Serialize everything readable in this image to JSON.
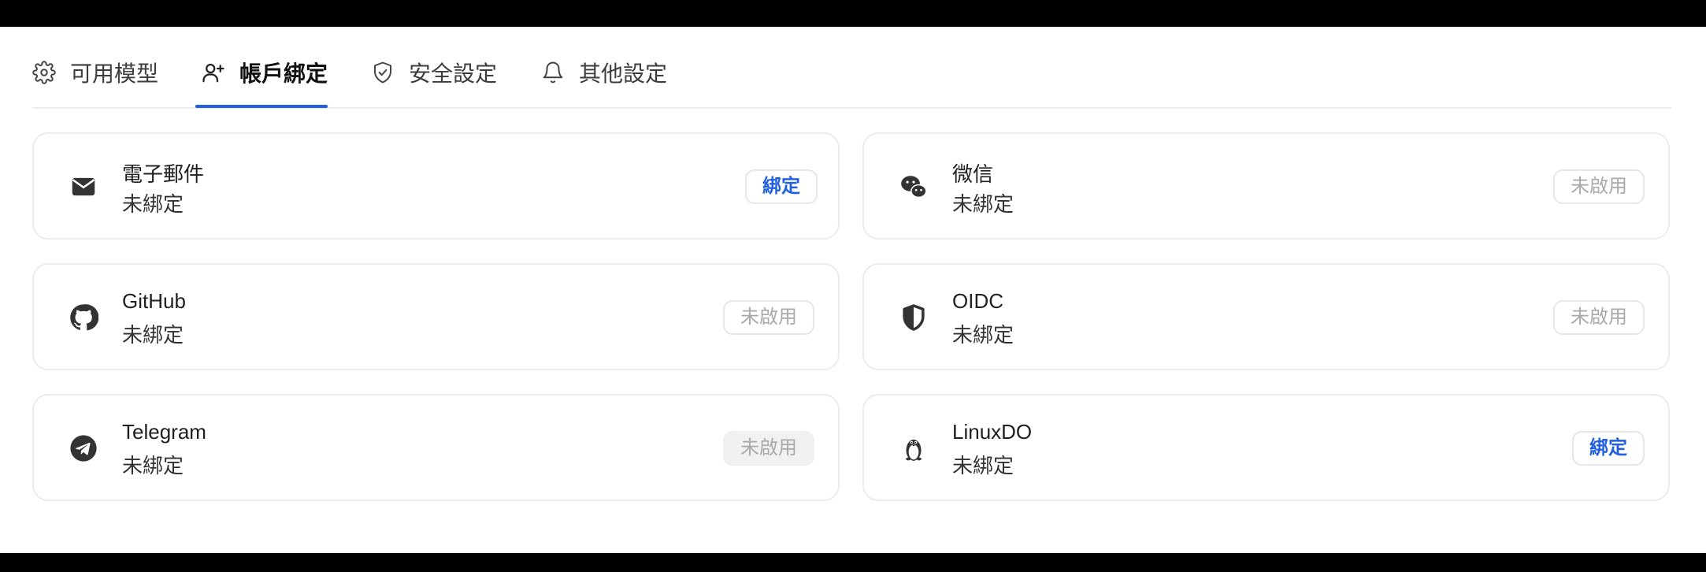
{
  "tabs": [
    {
      "label": "可用模型",
      "icon": "gear-icon",
      "active": false
    },
    {
      "label": "帳戶綁定",
      "icon": "user-plus-icon",
      "active": true
    },
    {
      "label": "安全設定",
      "icon": "shield-check-icon",
      "active": false
    },
    {
      "label": "其他設定",
      "icon": "bell-icon",
      "active": false
    }
  ],
  "colors": {
    "accent": "#1f5fe0",
    "disabled_text": "#a9a9a9",
    "border": "#ececec"
  },
  "cards": [
    {
      "name": "電子郵件",
      "status": "未綁定",
      "action": "綁定",
      "action_state": "enabled",
      "icon": "mail-icon"
    },
    {
      "name": "微信",
      "status": "未綁定",
      "action": "未啟用",
      "action_state": "disabled",
      "icon": "wechat-icon"
    },
    {
      "name": "GitHub",
      "status": "未綁定",
      "action": "未啟用",
      "action_state": "disabled",
      "icon": "github-icon"
    },
    {
      "name": "OIDC",
      "status": "未綁定",
      "action": "未啟用",
      "action_state": "disabled",
      "icon": "shield-half-icon"
    },
    {
      "name": "Telegram",
      "status": "未綁定",
      "action": "未啟用",
      "action_state": "disabled",
      "icon": "telegram-icon"
    },
    {
      "name": "LinuxDO",
      "status": "未綁定",
      "action": "綁定",
      "action_state": "enabled",
      "icon": "penguin-icon"
    }
  ]
}
